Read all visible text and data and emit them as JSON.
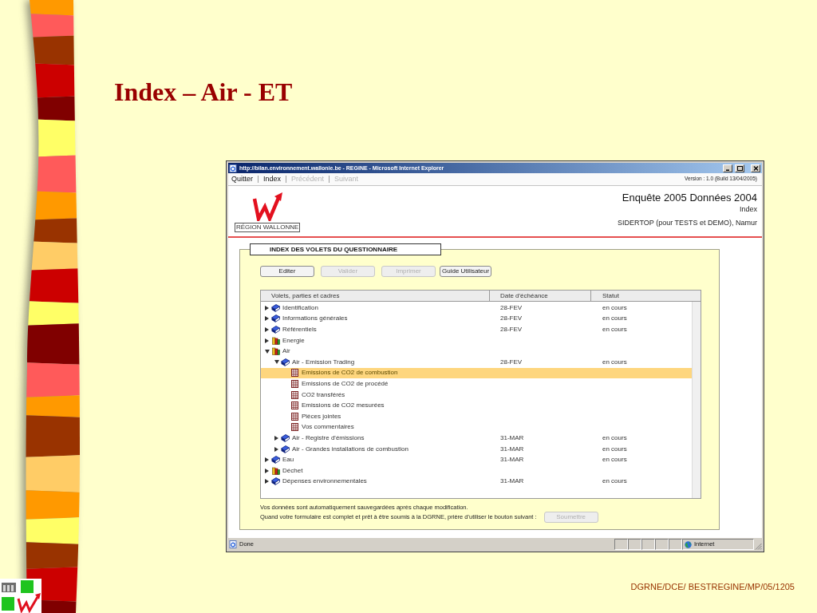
{
  "slide": {
    "title": "Index – Air - ET",
    "footer": "DGRNE/DCE/ BESTREGINE/MP/05/1205"
  },
  "browser": {
    "title": "http://bilan.environnement.wallonie.be - REGINE - Microsoft Internet Explorer",
    "status": "Done",
    "zone": "Internet"
  },
  "nav": {
    "links": [
      {
        "label": "Quitter",
        "disabled": false
      },
      {
        "label": "Index",
        "disabled": false
      },
      {
        "label": "Précédent",
        "disabled": true
      },
      {
        "label": "Suivant",
        "disabled": true
      }
    ],
    "version": "Version : 1.0 (Build 13/04/2005)"
  },
  "header": {
    "logo_caption": "RÉGION WALLONNE",
    "title": "Enquête 2005 Données 2004",
    "subtitle": "Index",
    "organisation": "SIDERTOP (pour TESTS et DEMO), Namur"
  },
  "panel": {
    "title": "INDEX DES VOLETS DU QUESTIONNAIRE",
    "buttons": [
      {
        "label": "Editer",
        "disabled": false
      },
      {
        "label": "Valider",
        "disabled": true
      },
      {
        "label": "Imprimer",
        "disabled": true
      },
      {
        "label": "Guide Utilisateur",
        "disabled": false
      }
    ],
    "table": {
      "columns": [
        "Volets, parties et cadres",
        "Date d'échéance",
        "Statut"
      ],
      "rows": [
        {
          "label": "Identification",
          "kind": "book",
          "expanded": false,
          "selected": false,
          "date": "28-FEV",
          "status": "en cours"
        },
        {
          "label": "Informations générales",
          "kind": "book",
          "expanded": false,
          "selected": false,
          "date": "28-FEV",
          "status": "en cours"
        },
        {
          "label": "Référentiels",
          "kind": "book",
          "expanded": false,
          "selected": false,
          "date": "28-FEV",
          "status": "en cours"
        },
        {
          "label": "Energie",
          "kind": "books",
          "expanded": false,
          "selected": false
        },
        {
          "label": "Air",
          "kind": "books",
          "expanded": true,
          "selected": false,
          "children": [
            {
              "label": "Air - Emission Trading",
              "kind": "book",
              "expanded": true,
              "selected": false,
              "date": "28-FEV",
              "status": "en cours",
              "children": [
                {
                  "label": "Emissions de CO2 de combustion",
                  "kind": "form",
                  "selected": true
                },
                {
                  "label": "Emissions de CO2 de procédé",
                  "kind": "form",
                  "selected": false
                },
                {
                  "label": "CO2 transférés",
                  "kind": "form",
                  "selected": false
                },
                {
                  "label": "Emissions de CO2 mesurées",
                  "kind": "form",
                  "selected": false
                },
                {
                  "label": "Pièces jointes",
                  "kind": "form",
                  "selected": false
                },
                {
                  "label": "Vos commentaires",
                  "kind": "form",
                  "selected": false
                }
              ]
            },
            {
              "label": "Air - Registre d'émissions",
              "kind": "book",
              "expanded": false,
              "selected": false,
              "date": "31-MAR",
              "status": "en cours"
            },
            {
              "label": "Air - Grandes installations de combustion",
              "kind": "book",
              "expanded": false,
              "selected": false,
              "date": "31-MAR",
              "status": "en cours"
            }
          ]
        },
        {
          "label": "Eau",
          "kind": "book",
          "expanded": false,
          "selected": false,
          "date": "31-MAR",
          "status": "en cours"
        },
        {
          "label": "Déchet",
          "kind": "books",
          "expanded": false,
          "selected": false
        },
        {
          "label": "Dépenses environnementales",
          "kind": "book",
          "expanded": false,
          "selected": false,
          "date": "31-MAR",
          "status": "en cours"
        }
      ]
    },
    "notes": [
      "Vos données sont automatiquement sauvegardées après chaque modification.",
      "Quand votre formulaire est complet et prêt à être soumis à la DGRNE, prière d'utiliser le bouton suivant :"
    ],
    "submit": {
      "label": "Soumettre",
      "disabled": true
    }
  }
}
